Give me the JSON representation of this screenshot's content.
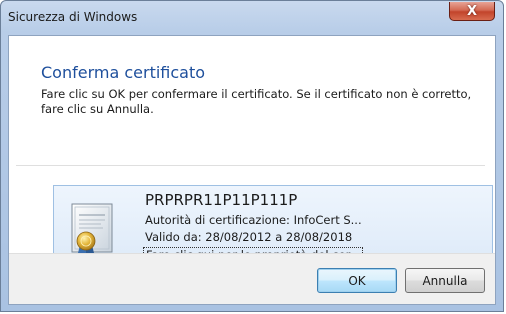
{
  "window": {
    "title": "Sicurezza di Windows",
    "close_glyph": "X"
  },
  "dialog": {
    "heading": "Conferma certificato",
    "instruction": "Fare clic su OK per confermare il certificato. Se il certificato non è corretto, fare clic su Annulla."
  },
  "certificate": {
    "icon": "certificate-icon",
    "name": "PRPRPR11P11P111P",
    "issuer": "Autorità di certificazione: InfoCert S...",
    "validity": "Valido da: 28/08/2012 a 28/08/2018",
    "properties_link": "Fare clic qui per le proprietà del cer..."
  },
  "buttons": {
    "ok": "OK",
    "cancel": "Annulla"
  },
  "colors": {
    "heading": "#1e4f9c",
    "close_button": "#c2442b",
    "tile_border": "#9fc0e3"
  }
}
